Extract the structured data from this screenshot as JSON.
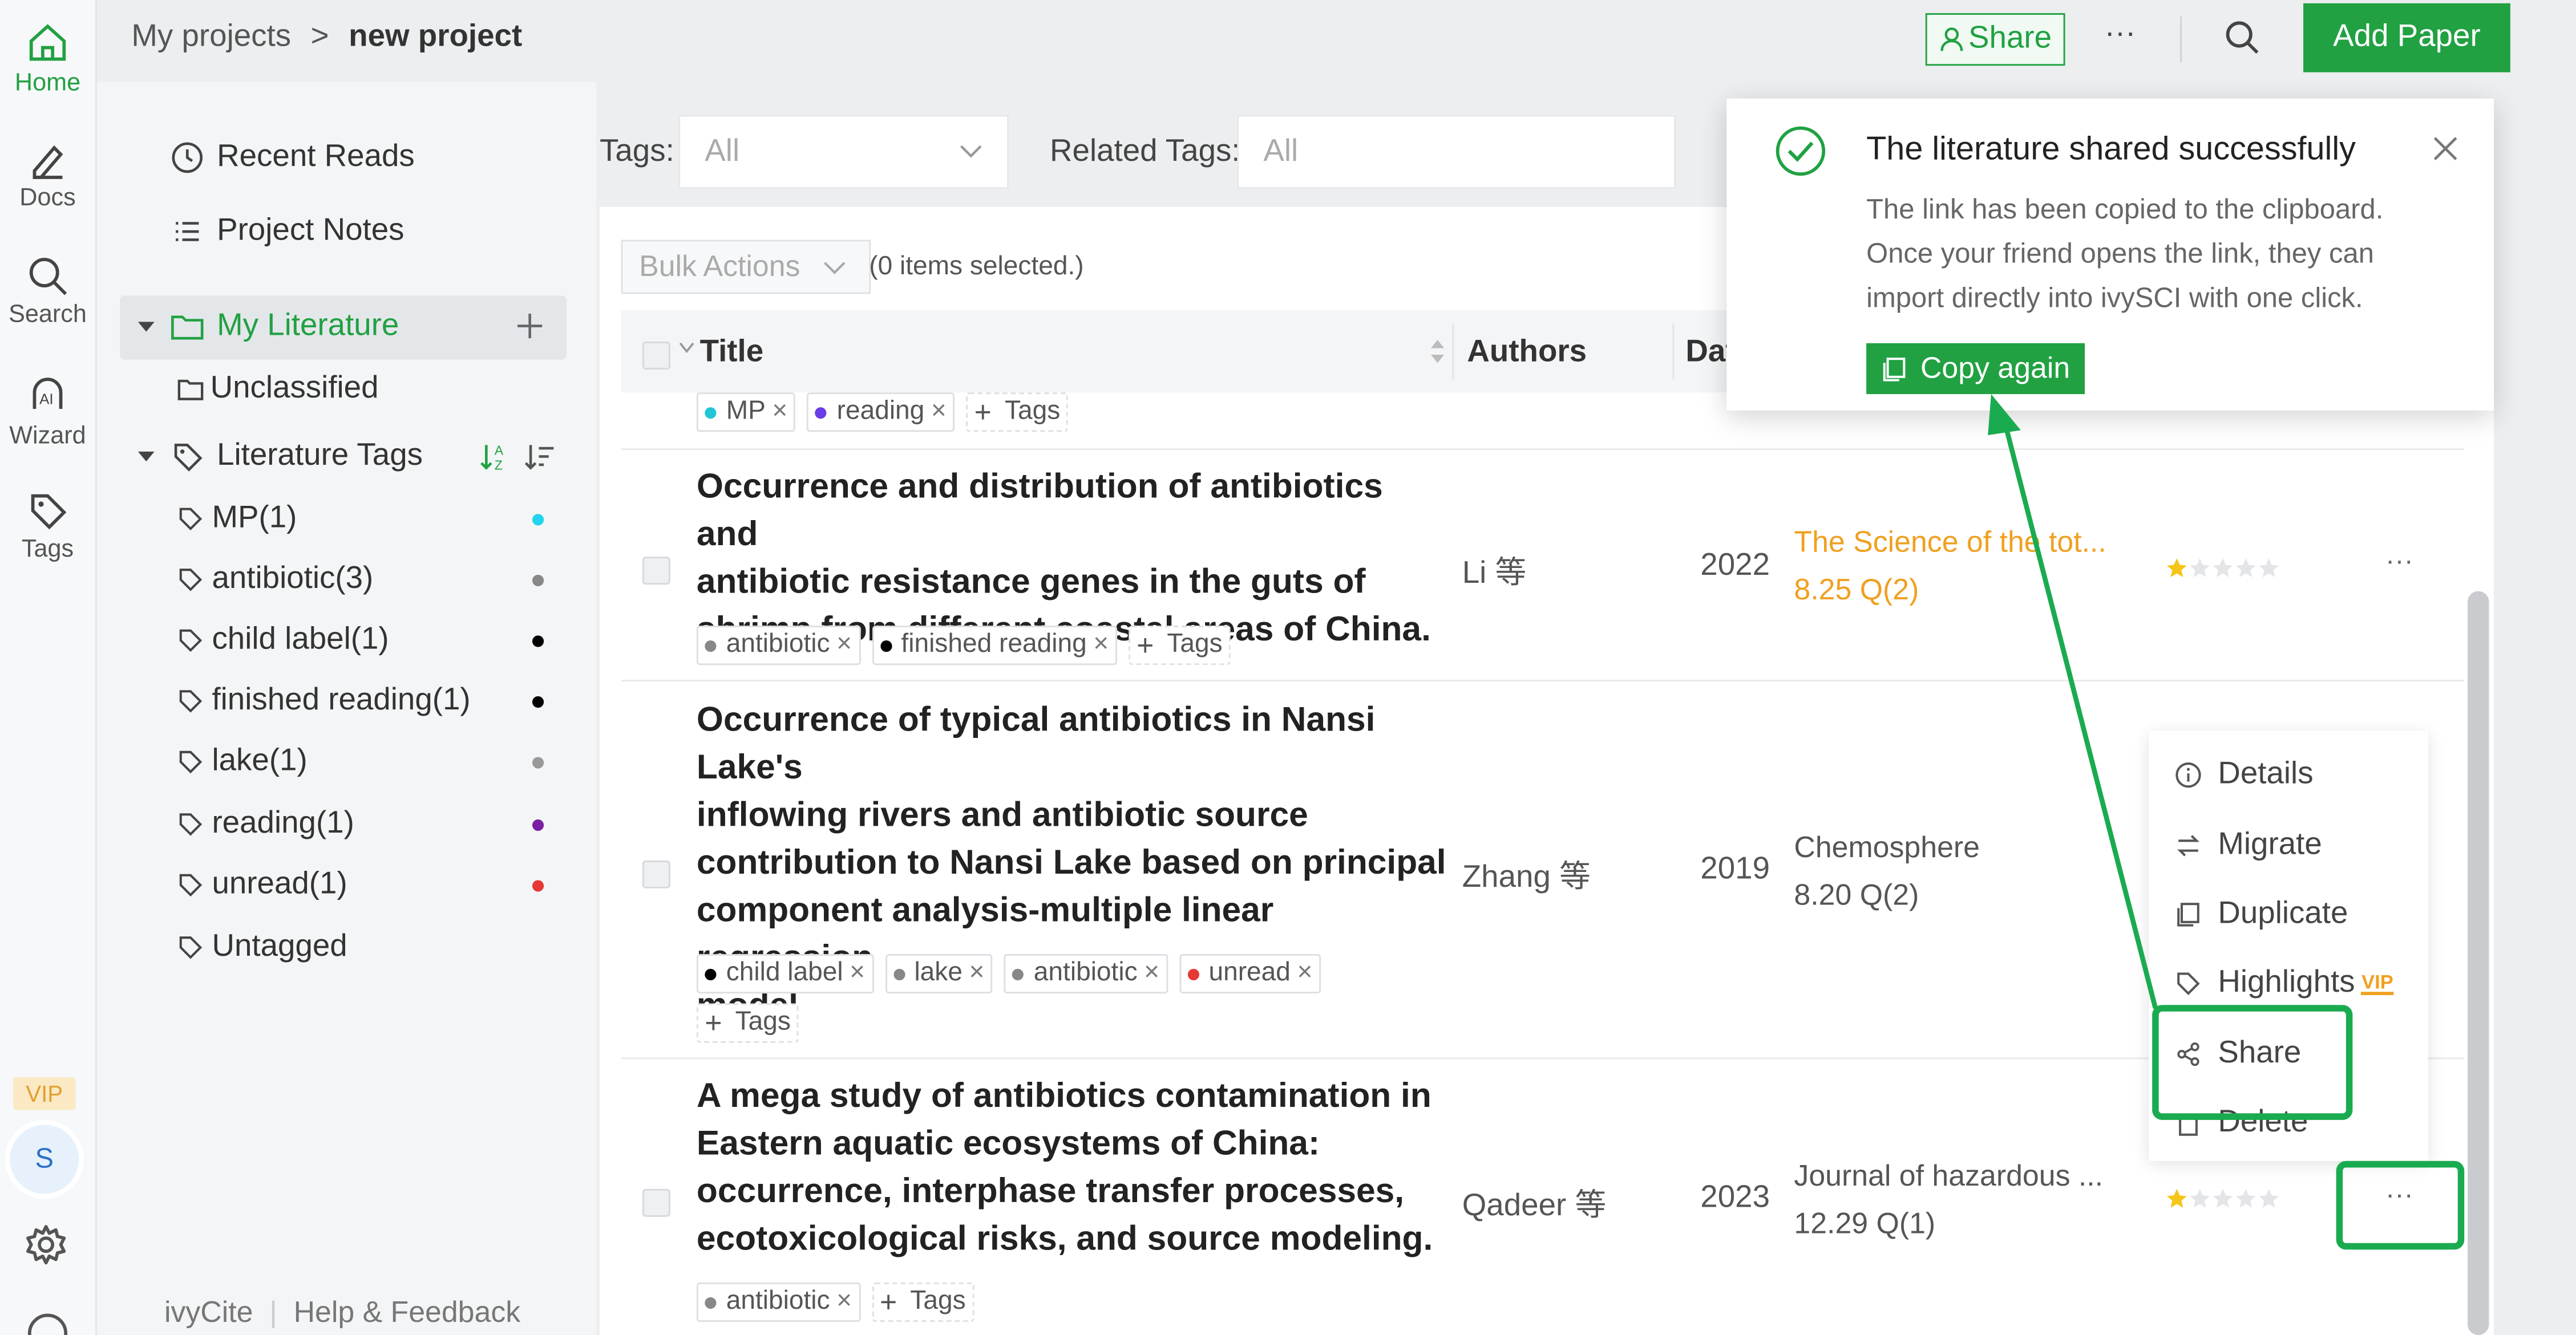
{
  "rail": {
    "home": "Home",
    "docs": "Docs",
    "search": "Search",
    "wizard": "Wizard",
    "tags": "Tags",
    "vip": "VIP",
    "avatar_initial": "S"
  },
  "breadcrumb": {
    "root": "My projects",
    "separator": ">",
    "current": "new project"
  },
  "header": {
    "share": "Share",
    "more": "···",
    "add_paper": "Add Paper"
  },
  "sidebar": {
    "recent_reads": "Recent Reads",
    "project_notes": "Project Notes",
    "my_literature": "My Literature",
    "unclassified": "Unclassified",
    "literature_tags": "Literature Tags",
    "tags": [
      {
        "label": "MP(1)",
        "color": "#22d3ee"
      },
      {
        "label": "antibiotic(3)",
        "color": "#888888"
      },
      {
        "label": "child label(1)",
        "color": "#000000"
      },
      {
        "label": "finished reading(1)",
        "color": "#000000"
      },
      {
        "label": "lake(1)",
        "color": "#999999"
      },
      {
        "label": "reading(1)",
        "color": "#7b1fa2"
      },
      {
        "label": "unread(1)",
        "color": "#e53935"
      },
      {
        "label": "Untagged",
        "color": ""
      }
    ],
    "footer_left": "ivyCite",
    "footer_sep": "|",
    "footer_right": "Help & Feedback"
  },
  "filters": {
    "tags_label": "Tags:",
    "tags_value": "All",
    "related_label": "Related Tags:",
    "related_value": "All"
  },
  "table": {
    "bulk_actions": "Bulk Actions",
    "selected": "(0 items selected.)",
    "col_title": "Title",
    "col_authors": "Authors",
    "col_date": "Dat"
  },
  "rows": [
    {
      "chips": [
        {
          "label": "MP",
          "color": "#22c5d6"
        },
        {
          "label": "reading",
          "color": "#6a3de8"
        }
      ],
      "add_tags": "Tags"
    },
    {
      "title_lines": [
        "Occurrence and distribution of antibiotics and",
        "antibiotic resistance genes in the guts of",
        "shrimp from different coastal areas of China."
      ],
      "author": "Li 等",
      "year": "2022",
      "journal": "The Science of the tot...",
      "metric": "8.25 Q(2)",
      "chips": [
        {
          "label": "antibiotic",
          "color": "#888888"
        },
        {
          "label": "finished reading",
          "color": "#000000"
        }
      ],
      "add_tags": "Tags",
      "more": "···"
    },
    {
      "title_lines": [
        "Occurrence of typical antibiotics in Nansi Lake's",
        "inflowing rivers and antibiotic source",
        "contribution to Nansi Lake based on principal",
        "component analysis-multiple linear regression",
        "model"
      ],
      "author": "Zhang 等",
      "year": "2019",
      "journal": "Chemosphere",
      "metric": "8.20 Q(2)",
      "chips": [
        {
          "label": "child label",
          "color": "#000000"
        },
        {
          "label": "lake",
          "color": "#888888"
        },
        {
          "label": "antibiotic",
          "color": "#888888"
        },
        {
          "label": "unread",
          "color": "#e53935"
        }
      ],
      "add_tags": "Tags"
    },
    {
      "title_lines": [
        "A mega study of antibiotics contamination in",
        "Eastern aquatic ecosystems of China:",
        "occurrence, interphase transfer processes,",
        "ecotoxicological risks, and source modeling."
      ],
      "author": "Qadeer 等",
      "year": "2023",
      "journal": "Journal of hazardous ...",
      "metric": "12.29 Q(1)",
      "chips": [
        {
          "label": "antibiotic",
          "color": "#888888"
        }
      ],
      "add_tags": "Tags",
      "more": "···"
    }
  ],
  "context_menu": {
    "details": "Details",
    "migrate": "Migrate",
    "duplicate": "Duplicate",
    "highlights": "Highlights",
    "highlights_badge": "VIP",
    "share": "Share",
    "delete": "Delete"
  },
  "toast": {
    "title": "The literature shared successfully",
    "line1": "The link has been copied to the clipboard.",
    "line2": "Once your friend opens the link, they can",
    "line3": "import directly into ivySCI with one click.",
    "button": "Copy again"
  },
  "colors": {
    "brand_green": "#21a142",
    "annotation_green": "#1aab50",
    "orange": "#f0a020",
    "star": "#f5c518"
  }
}
